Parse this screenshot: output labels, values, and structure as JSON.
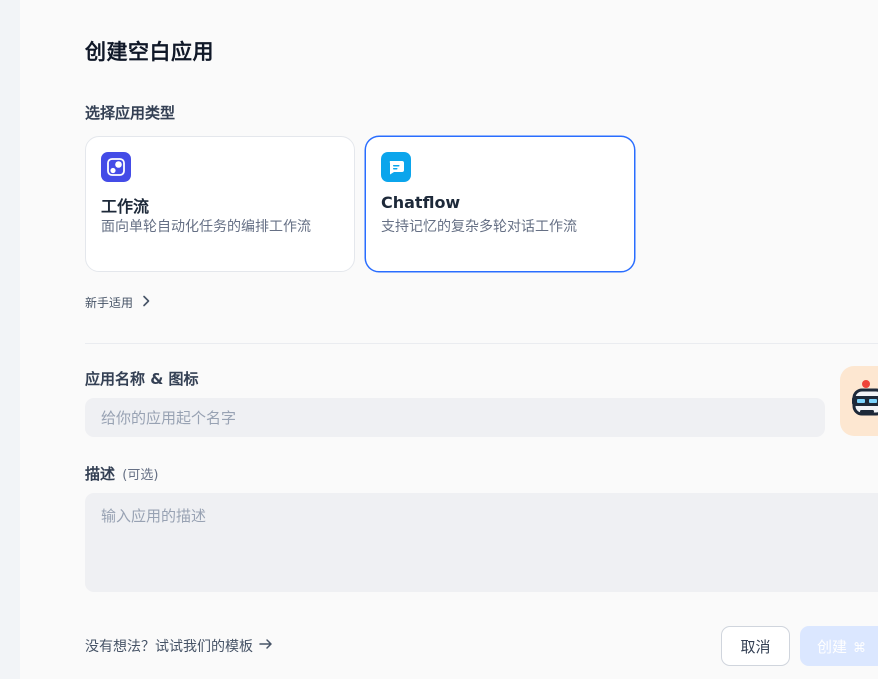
{
  "page": {
    "title": "创建空白应用"
  },
  "app_type": {
    "label": "选择应用类型",
    "cards": [
      {
        "title": "工作流",
        "description": "面向单轮自动化任务的编排工作流",
        "icon": "workflow-icon",
        "icon_color": "#444ce7",
        "selected": false
      },
      {
        "title": "Chatflow",
        "description": "支持记忆的复杂多轮对话工作流",
        "icon": "chat-bubble-icon",
        "icon_color": "#0ba5ec",
        "selected": true
      }
    ],
    "beginner_link": "新手适用"
  },
  "name_section": {
    "label": "应用名称 & 图标",
    "placeholder": "给你的应用起个名字",
    "value": "",
    "avatar_icon": "robot-emoji-icon",
    "avatar_bg": "#fde7d1"
  },
  "description_section": {
    "label": "描述",
    "optional": "(可选)",
    "placeholder": "输入应用的描述",
    "value": ""
  },
  "footer": {
    "template_link": "没有想法？试试我们的模板",
    "cancel_label": "取消",
    "create_label": "创建",
    "create_shortcut": "⌘"
  },
  "colors": {
    "accent": "#296dff",
    "create_disabled_bg": "#dbe7ff"
  }
}
